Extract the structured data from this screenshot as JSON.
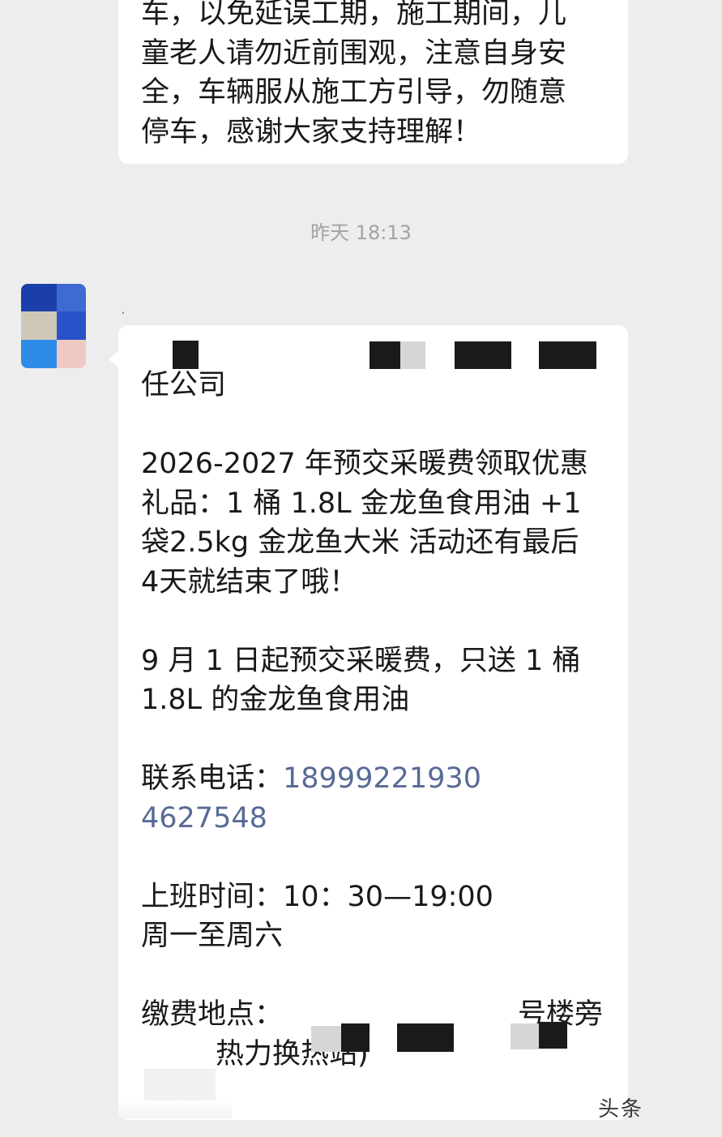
{
  "previous_message": {
    "lines": [
      "车，以免延误工期，施工期间，儿",
      "童老人请勿近前围观，注意自身安",
      "全，车辆服从施工方引导，勿随意",
      "停车，感谢大家支持理解！"
    ]
  },
  "timestamp": "昨天 18:13",
  "sender": {
    "name": "·",
    "avatar_colors": [
      "#1a3faa",
      "#3f6ad4",
      "#cfc8b8",
      "#2a52c8",
      "#2f8be8",
      "#f0c8c4"
    ]
  },
  "message": {
    "company_line": "任公司",
    "promo_lines": [
      "2026-2027 年预交采暖费领取优惠",
      "礼品：1 桶 1.8L 金龙鱼食用油 +1",
      "袋2.5kg 金龙鱼大米 活动还有最后",
      "4天就结束了哦！"
    ],
    "notice_lines": [
      "9 月 1 日起预交采暖费，只送 1 桶",
      "1.8L 的金龙鱼食用油"
    ],
    "phone_label": "联系电话：",
    "phone_1": "18999221930",
    "phone_2": "4627548",
    "hours_label_line": "上班时间：10：30—19:00",
    "hours_days": "周一至周六",
    "address_label": "缴费地点：",
    "address_fragment": "号楼旁",
    "address_line2": "热力换热站)"
  },
  "watermark": "头条"
}
